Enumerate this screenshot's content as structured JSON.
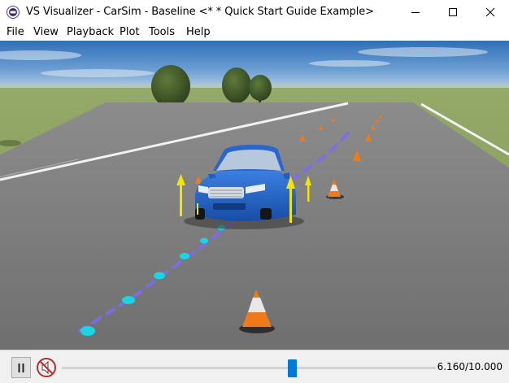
{
  "window": {
    "title": "VS Visualizer - CarSim - Baseline <* * Quick Start Guide Example>",
    "app_icon": "vs-visualizer-icon",
    "controls": [
      "minimize-icon",
      "maximize-icon",
      "close-icon"
    ]
  },
  "menu": {
    "items": [
      {
        "label": "File"
      },
      {
        "label": "View"
      },
      {
        "label": "Playback"
      },
      {
        "label": "Plot"
      },
      {
        "label": "Tools"
      },
      {
        "label": "Help"
      }
    ]
  },
  "scene": {
    "description_icons": [
      "car",
      "traffic-cone",
      "force-vector-arrow",
      "path-marker"
    ],
    "colors": {
      "sky": "#4f86c6",
      "grass": "#8aa05a",
      "road": "#7d7d7d",
      "car": "#1f5fc4",
      "cone": "#f07a1a",
      "marker": "#19d6e6",
      "path_line": "#7b6cf2",
      "arrow": "#f2e500"
    }
  },
  "playback": {
    "pause_icon": "pause-icon",
    "mute_icon": "mute-icon",
    "time_text": "6.160/10.000",
    "progress": 0.616
  }
}
